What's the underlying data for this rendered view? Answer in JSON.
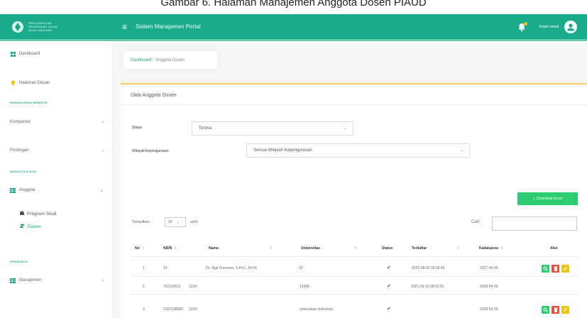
{
  "caption": "Gambar 6. Halaman Manajemen Anggota Dosen PIAUD",
  "brand": {
    "line1": "PERKUMPULAN",
    "line2": "PENDIDIKAN ISLAM",
    "line3": "ANAK USIA DINI"
  },
  "header": {
    "app_title": "Sistem Manajemen Portal",
    "user_name": "Enjah Ismail"
  },
  "sidebar": {
    "dashboard": "Dashboard",
    "halaman_depan": "Halaman Depan",
    "section_website": "PENGATURAN WEBSITE",
    "komponen": "Komponen",
    "postingan": "Postingan",
    "section_pengguna": "ANGGOTA PIAUD",
    "anggota": "Anggota",
    "program_studi": "Program Studi",
    "dosen": "Dosen",
    "section_pengurus": "PENGURUS",
    "manajemen": "Manajemen"
  },
  "breadcrumb": {
    "home": "Dashboard",
    "separator": "/",
    "current": "Anggota Dosen"
  },
  "card": {
    "title": "Data Anggota Dosen"
  },
  "filters": {
    "status_label": "Status",
    "status_value": "Terima",
    "wilayah_label": "Wilayah Kepengurusan",
    "wilayah_value": "Semua Wilayah Kepengurusan"
  },
  "download_button": "Download Excel",
  "table_controls": {
    "show_label": "Tampilkan",
    "length_value": "10",
    "entries_label": "entri",
    "search_label": "Cari:"
  },
  "table": {
    "headers": [
      "No",
      "NIDN",
      "Nama",
      "Universitas",
      "Status",
      "Terdaftar",
      "Kadaluarsa",
      "Aksi"
    ],
    "rows": [
      {
        "no": "1",
        "nidn": "10",
        "nama": "Dr. Sigit Purnomo, S.Pd.I., M.Pd.",
        "universitas": "33",
        "terdaftar": "2022-08-02 09:08:46",
        "kadaluarsa": "2027-04-30"
      },
      {
        "no": "2",
        "nidn": "762142611",
        "nama": "1234",
        "universitas": "12345",
        "terdaftar": "2021-09-15 08:52:01",
        "kadaluarsa": "2028-04-30"
      },
      {
        "no": "3",
        "nidn": "1203108683",
        "nama": "1234",
        "universitas": "universitas Indonesia",
        "terdaftar": "",
        "kadaluarsa": "2028-04-30"
      }
    ]
  },
  "colors": {
    "topbar": "#1aab8a",
    "accent_line": "#f4d35e",
    "view": "#2ecc71",
    "delete": "#e74c3c",
    "edit": "#f1c40f"
  },
  "icons": {
    "menu": "hamburger-icon",
    "bell": "bell-icon",
    "avatar": "user-circle-icon",
    "check": "check-icon",
    "view": "search-icon",
    "delete": "trash-icon",
    "edit": "pencil-icon"
  }
}
